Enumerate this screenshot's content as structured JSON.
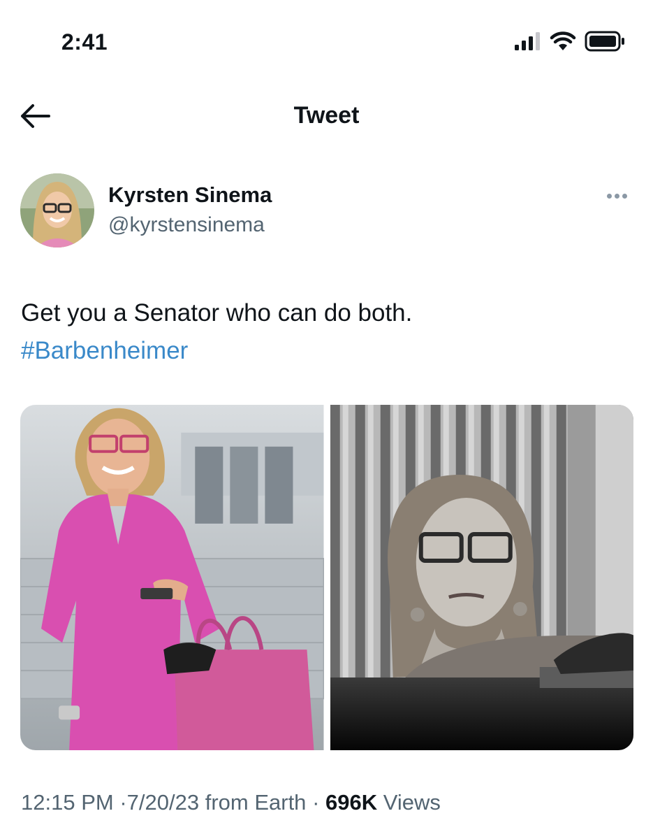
{
  "status_bar": {
    "time": "2:41",
    "icons": [
      "cellular-signal-icon",
      "wifi-icon",
      "battery-icon"
    ]
  },
  "nav": {
    "back_icon": "arrow-left-icon",
    "title": "Tweet"
  },
  "tweet": {
    "author": {
      "name": "Kyrsten Sinema",
      "handle": "@kyrstensinema"
    },
    "text": "Get you a Senator who can do both.",
    "hashtag": "#Barbenheimer",
    "media_count": 2,
    "meta": {
      "time": "12:15 PM",
      "separator": "·",
      "date": "7/20/23",
      "source": "from Earth",
      "views_count": "696K",
      "views_label": "Views"
    }
  },
  "colors": {
    "text": "#0f1419",
    "secondary": "#536471",
    "link": "#3a89c9",
    "dress_pink": "#d94fb0"
  }
}
